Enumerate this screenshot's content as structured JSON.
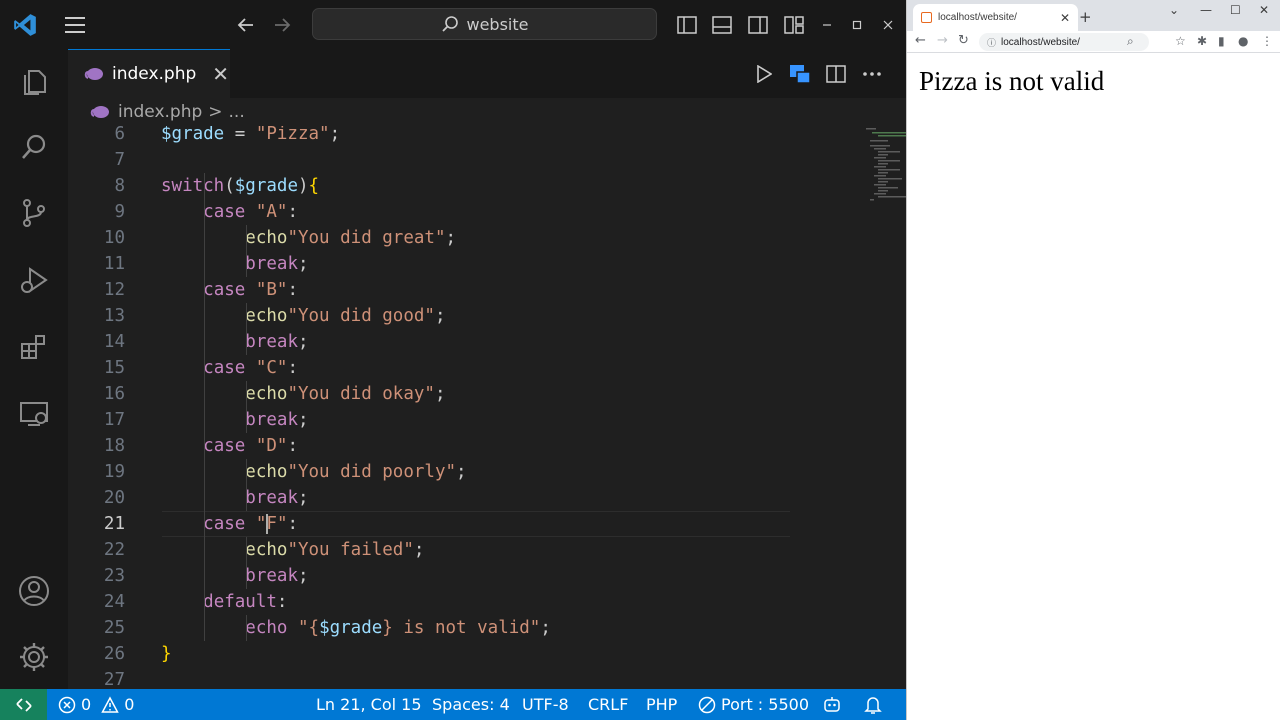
{
  "vscode": {
    "search": {
      "label": "website"
    },
    "tab": {
      "label": "index.php",
      "close": "✕"
    },
    "breadcrumb": {
      "file": "index.php",
      "sep": ">",
      "more": "..."
    },
    "editor": {
      "active_line": 21,
      "lines": [
        {
          "n": "6",
          "tokens": [
            {
              "t": "$grade",
              "c": "var"
            },
            {
              "t": " = ",
              "c": "punc"
            },
            {
              "t": "\"Pizza\"",
              "c": "str"
            },
            {
              "t": ";",
              "c": "punc"
            }
          ]
        },
        {
          "n": "7",
          "tokens": []
        },
        {
          "n": "8",
          "tokens": [
            {
              "t": "switch",
              "c": "kw"
            },
            {
              "t": "(",
              "c": "punc"
            },
            {
              "t": "$grade",
              "c": "var"
            },
            {
              "t": ")",
              "c": "punc"
            },
            {
              "t": "{",
              "c": "brace"
            }
          ]
        },
        {
          "n": "9",
          "tokens": [
            {
              "t": "    "
            },
            {
              "t": "case",
              "c": "kw"
            },
            {
              "t": " "
            },
            {
              "t": "\"A\"",
              "c": "str"
            },
            {
              "t": ":",
              "c": "punc"
            }
          ]
        },
        {
          "n": "10",
          "tokens": [
            {
              "t": "        "
            },
            {
              "t": "echo",
              "c": "fn"
            },
            {
              "t": "\"You did great\"",
              "c": "str"
            },
            {
              "t": ";",
              "c": "punc"
            }
          ]
        },
        {
          "n": "11",
          "tokens": [
            {
              "t": "        "
            },
            {
              "t": "break",
              "c": "kw"
            },
            {
              "t": ";",
              "c": "punc"
            }
          ]
        },
        {
          "n": "12",
          "tokens": [
            {
              "t": "    "
            },
            {
              "t": "case",
              "c": "kw"
            },
            {
              "t": " "
            },
            {
              "t": "\"B\"",
              "c": "str"
            },
            {
              "t": ":",
              "c": "punc"
            }
          ]
        },
        {
          "n": "13",
          "tokens": [
            {
              "t": "        "
            },
            {
              "t": "echo",
              "c": "fn"
            },
            {
              "t": "\"You did good\"",
              "c": "str"
            },
            {
              "t": ";",
              "c": "punc"
            }
          ]
        },
        {
          "n": "14",
          "tokens": [
            {
              "t": "        "
            },
            {
              "t": "break",
              "c": "kw"
            },
            {
              "t": ";",
              "c": "punc"
            }
          ]
        },
        {
          "n": "15",
          "tokens": [
            {
              "t": "    "
            },
            {
              "t": "case",
              "c": "kw"
            },
            {
              "t": " "
            },
            {
              "t": "\"C\"",
              "c": "str"
            },
            {
              "t": ":",
              "c": "punc"
            }
          ]
        },
        {
          "n": "16",
          "tokens": [
            {
              "t": "        "
            },
            {
              "t": "echo",
              "c": "fn"
            },
            {
              "t": "\"You did okay\"",
              "c": "str"
            },
            {
              "t": ";",
              "c": "punc"
            }
          ]
        },
        {
          "n": "17",
          "tokens": [
            {
              "t": "        "
            },
            {
              "t": "break",
              "c": "kw"
            },
            {
              "t": ";",
              "c": "punc"
            }
          ]
        },
        {
          "n": "18",
          "tokens": [
            {
              "t": "    "
            },
            {
              "t": "case",
              "c": "kw"
            },
            {
              "t": " "
            },
            {
              "t": "\"D\"",
              "c": "str"
            },
            {
              "t": ":",
              "c": "punc"
            }
          ]
        },
        {
          "n": "19",
          "tokens": [
            {
              "t": "        "
            },
            {
              "t": "echo",
              "c": "fn"
            },
            {
              "t": "\"You did poorly\"",
              "c": "str"
            },
            {
              "t": ";",
              "c": "punc"
            }
          ]
        },
        {
          "n": "20",
          "tokens": [
            {
              "t": "        "
            },
            {
              "t": "break",
              "c": "kw"
            },
            {
              "t": ";",
              "c": "punc"
            }
          ]
        },
        {
          "n": "21",
          "tokens": [
            {
              "t": "    "
            },
            {
              "t": "case",
              "c": "kw"
            },
            {
              "t": " "
            },
            {
              "t": "\"",
              "c": "str"
            },
            {
              "t": "",
              "c": "caret"
            },
            {
              "t": "F\"",
              "c": "str"
            },
            {
              "t": ":",
              "c": "punc"
            }
          ]
        },
        {
          "n": "22",
          "tokens": [
            {
              "t": "        "
            },
            {
              "t": "echo",
              "c": "fn"
            },
            {
              "t": "\"You failed\"",
              "c": "str"
            },
            {
              "t": ";",
              "c": "punc"
            }
          ]
        },
        {
          "n": "23",
          "tokens": [
            {
              "t": "        "
            },
            {
              "t": "break",
              "c": "kw"
            },
            {
              "t": ";",
              "c": "punc"
            }
          ]
        },
        {
          "n": "24",
          "tokens": [
            {
              "t": "    "
            },
            {
              "t": "default",
              "c": "kw"
            },
            {
              "t": ":",
              "c": "punc"
            }
          ]
        },
        {
          "n": "25",
          "tokens": [
            {
              "t": "        "
            },
            {
              "t": "echo",
              "c": "kw"
            },
            {
              "t": " "
            },
            {
              "t": "\"{",
              "c": "str"
            },
            {
              "t": "$grade",
              "c": "var"
            },
            {
              "t": "} is not valid\"",
              "c": "str"
            },
            {
              "t": ";",
              "c": "punc"
            }
          ]
        },
        {
          "n": "26",
          "tokens": [
            {
              "t": "}",
              "c": "brace"
            }
          ]
        },
        {
          "n": "27",
          "tokens": []
        }
      ],
      "closing_tag": "?>"
    },
    "statusbar": {
      "errors": "0",
      "warnings": "0",
      "position": "Ln 21, Col 15",
      "spaces": "Spaces: 4",
      "encoding": "UTF-8",
      "eol": "CRLF",
      "language": "PHP",
      "port": "Port : 5500"
    },
    "colors": {
      "accent": "#0078d4",
      "remote": "#16825d",
      "keyword": "#c586c0",
      "variable": "#9cdcfe",
      "string": "#ce9178",
      "function": "#dcdcaa"
    }
  },
  "browser": {
    "tab_title": "localhost/website/",
    "url": "localhost/website/",
    "output": "Pizza is not valid"
  }
}
